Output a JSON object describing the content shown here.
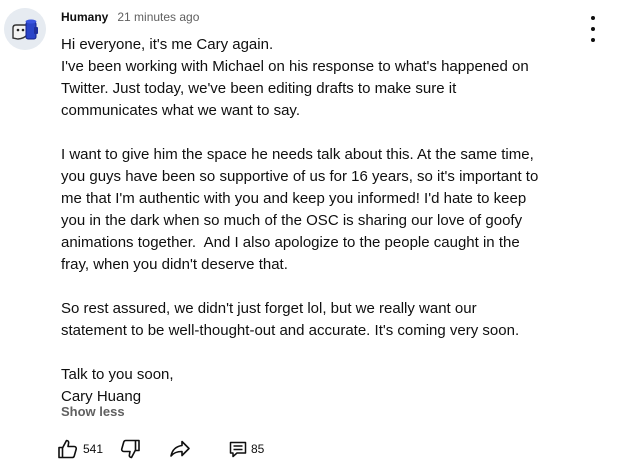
{
  "comment": {
    "author": "Humany",
    "timestamp": "21 minutes ago",
    "paragraphs": [
      [
        "Hi everyone, it's me Cary again.",
        "I've been working with Michael on his response to what's happened on",
        "Twitter. Just today, we've been editing drafts to make sure it",
        "communicates what we want to say."
      ],
      [
        "I want to give him the space he needs talk about this. At the same time,",
        "you guys have been so supportive of us for 16 years, so it's important to",
        "me that I'm authentic with you and keep you informed! I'd hate to keep",
        "you in the dark when so much of the OSC is sharing our love of goofy",
        "animations together.  And I also apologize to the people caught in the",
        "fray, when you didn't deserve that."
      ],
      [
        "So rest assured, we didn't just forget lol, but we really want our",
        "statement to be well-thought-out and accurate. It's coming very soon."
      ],
      [
        "Talk to you soon,",
        "Cary Huang"
      ]
    ],
    "show_less_label": "Show less",
    "like_count": "541",
    "reply_count": "85"
  },
  "icons": {
    "menu": "more-vertical-icon",
    "like": "thumb-up-icon",
    "dislike": "thumb-down-icon",
    "share": "share-icon",
    "replies": "comment-icon"
  },
  "colors": {
    "text": "#0f0f0f",
    "secondary_text": "#606060"
  }
}
